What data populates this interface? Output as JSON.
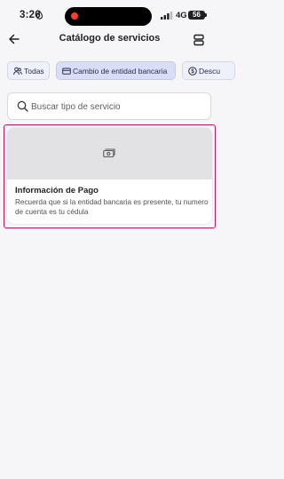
{
  "status_bar": {
    "time": "3:26",
    "network": "4G",
    "battery": "56"
  },
  "header": {
    "title": "Catálogo de servicios",
    "back_icon": "arrow-left-icon",
    "menu_icon": "stack-icon"
  },
  "tabs": [
    {
      "label": "Todas",
      "icon": "people-icon",
      "selected": false
    },
    {
      "label": "Cambio de entidad bancaria",
      "icon": "card-icon",
      "selected": true
    },
    {
      "label": "Descu",
      "icon": "dollar-circle-icon",
      "selected": false
    }
  ],
  "search": {
    "placeholder": "Buscar tipo de servicio",
    "value": ""
  },
  "services": [
    {
      "title": "Información de Pago",
      "description": "Recuerda que si la entidad bancaria es presente, tu numero de cuenta es tu cédula",
      "image_icon": "money-icon"
    }
  ],
  "colors": {
    "accent": "#d9ddf6",
    "highlight_outline": "#c2185b",
    "recording_dot": "#ff3b30"
  }
}
